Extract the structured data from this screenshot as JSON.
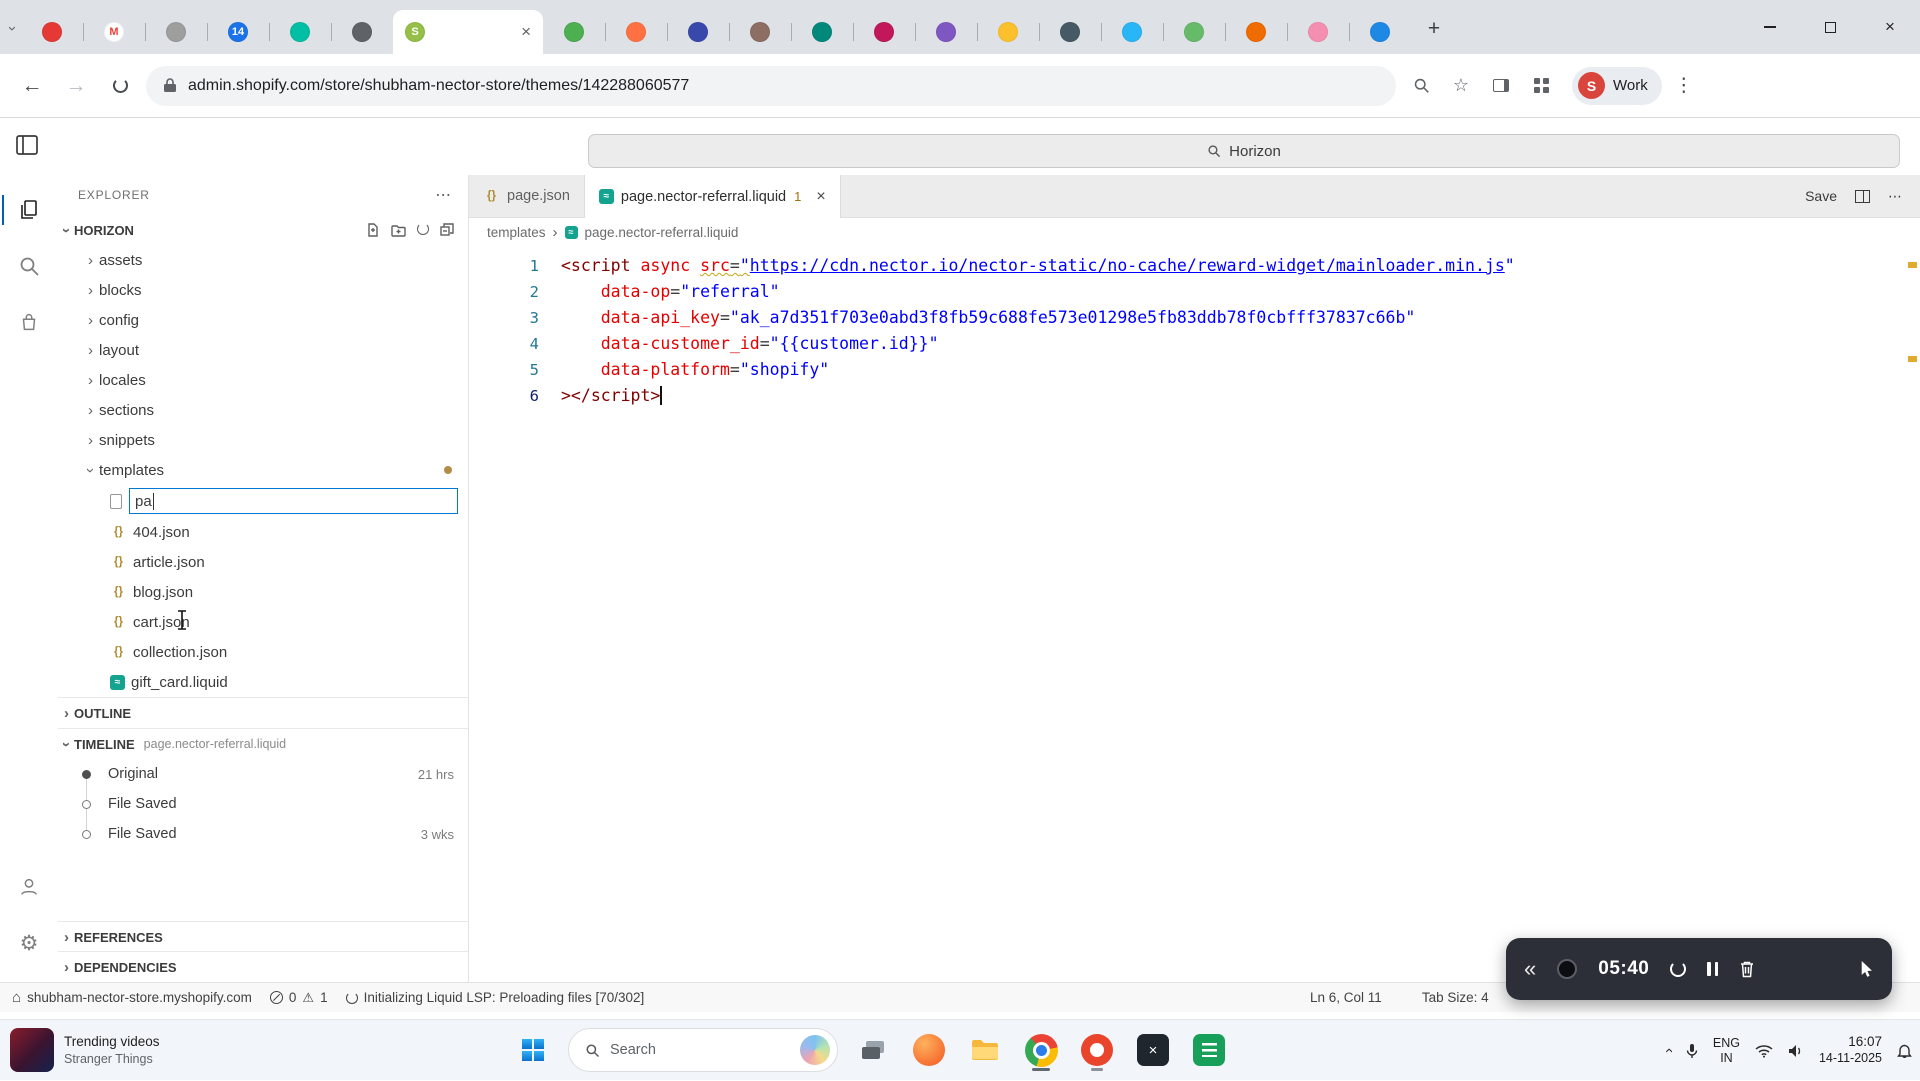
{
  "icons": {
    "chevron": "›",
    "more": "⋯",
    "kebab": "⋮",
    "close": "×",
    "plus": "+",
    "back": "←",
    "forward": "→",
    "guillemet": "«",
    "gear": "⚙",
    "warning": "⚠",
    "house": "⌂",
    "star": "☆",
    "json": "{}",
    "liquid": "≈"
  },
  "browser": {
    "tabs": [
      {
        "color": "#e53935"
      },
      {
        "color": "#ffffff",
        "letter": "M",
        "letter_color": "#ea4335"
      },
      {
        "color": "#9e9e9e"
      },
      {
        "color": "#1a73e8",
        "letter": "14"
      },
      {
        "color": "#00bfa5"
      },
      {
        "color": "#5f6368"
      },
      {
        "color": "#95bf47",
        "letter": "S",
        "active": true
      },
      {
        "color": "#4caf50"
      },
      {
        "color": "#ff7043"
      },
      {
        "color": "#3949ab"
      },
      {
        "color": "#8d6e63"
      },
      {
        "color": "#00897b"
      },
      {
        "color": "#c2185b"
      },
      {
        "color": "#7e57c2"
      },
      {
        "color": "#fbc02d"
      },
      {
        "color": "#455a64"
      },
      {
        "color": "#29b6f6"
      },
      {
        "color": "#66bb6a"
      },
      {
        "color": "#ef6c00"
      },
      {
        "color": "#f48fb1"
      },
      {
        "color": "#1e88e5"
      }
    ],
    "url": "admin.shopify.com/store/shubham-nector-store/themes/142288060577",
    "profile_name": "Work",
    "profile_initial": "S"
  },
  "command_center": {
    "label": "Horizon"
  },
  "explorer": {
    "title": "EXPLORER",
    "section": "HORIZON",
    "folders": [
      "assets",
      "blocks",
      "config",
      "layout",
      "locales",
      "sections",
      "snippets"
    ],
    "expanded_folder": "templates",
    "new_file_value": "pa",
    "files": [
      {
        "name": "404.json",
        "type": "json"
      },
      {
        "name": "article.json",
        "type": "json"
      },
      {
        "name": "blog.json",
        "type": "json"
      },
      {
        "name": "cart.json",
        "type": "json"
      },
      {
        "name": "collection.json",
        "type": "json"
      },
      {
        "name": "gift_card.liquid",
        "type": "liquid"
      }
    ],
    "outline_title": "OUTLINE",
    "timeline_title": "TIMELINE",
    "timeline_file": "page.nector-referral.liquid",
    "timeline_entries": [
      {
        "label": "Original",
        "time": "21 hrs",
        "filled": true
      },
      {
        "label": "File Saved",
        "time": "",
        "filled": false
      },
      {
        "label": "File Saved",
        "time": "3 wks",
        "filled": false
      }
    ],
    "references_title": "REFERENCES",
    "dependencies_title": "DEPENDENCIES"
  },
  "editor": {
    "tabs": [
      {
        "name": "page.json",
        "type": "json",
        "active": false
      },
      {
        "name": "page.nector-referral.liquid",
        "type": "liquid",
        "active": true,
        "badge": "1"
      }
    ],
    "save_label": "Save",
    "breadcrumbs": [
      "templates",
      "page.nector-referral.liquid"
    ],
    "code_lines": [
      {
        "n": "1",
        "tokens": [
          {
            "t": "<script",
            "c": "tag"
          },
          {
            "t": " "
          },
          {
            "t": "async",
            "c": "attr"
          },
          {
            "t": " "
          },
          {
            "t": "src",
            "c": "attr sq"
          },
          {
            "t": "=",
            "c": "eq sq"
          },
          {
            "t": "\"",
            "c": "str sq"
          },
          {
            "t": "https://cdn.nector.io/nector-static/no-cache/reward-widget/mainloader.min.js",
            "c": "str link"
          },
          {
            "t": "\"",
            "c": "str"
          }
        ]
      },
      {
        "n": "2",
        "tokens": [
          {
            "t": "    "
          },
          {
            "t": "data-op",
            "c": "attr"
          },
          {
            "t": "=",
            "c": "eq"
          },
          {
            "t": "\"referral\"",
            "c": "str"
          }
        ]
      },
      {
        "n": "3",
        "tokens": [
          {
            "t": "    "
          },
          {
            "t": "data-api_key",
            "c": "attr"
          },
          {
            "t": "=",
            "c": "eq"
          },
          {
            "t": "\"ak_a7d351f703e0abd3f8fb59c688fe573e01298e5fb83ddb78f0cbfff37837c66b\"",
            "c": "str"
          }
        ]
      },
      {
        "n": "4",
        "tokens": [
          {
            "t": "    "
          },
          {
            "t": "data-customer_id",
            "c": "attr"
          },
          {
            "t": "=",
            "c": "eq"
          },
          {
            "t": "\"{{customer.id}}\"",
            "c": "str"
          }
        ]
      },
      {
        "n": "5",
        "tokens": [
          {
            "t": "    "
          },
          {
            "t": "data-platform",
            "c": "attr"
          },
          {
            "t": "=",
            "c": "eq"
          },
          {
            "t": "\"shopify\"",
            "c": "str"
          }
        ]
      },
      {
        "n": "6",
        "cur": true,
        "tokens": [
          {
            "t": "></",
            "c": "tag"
          },
          {
            "t": "script",
            "c": "tag"
          },
          {
            "t": ">",
            "c": "tag"
          },
          {
            "t": "",
            "c": "caret"
          }
        ]
      }
    ]
  },
  "status_bar": {
    "store": "shubham-nector-store.myshopify.com",
    "errors": "0",
    "warnings": "1",
    "message": "Initializing Liquid LSP: Preloading files [70/302]",
    "line_col": "Ln 6, Col 11",
    "tab_size": "Tab Size: 4"
  },
  "recorder": {
    "time": "05:40"
  },
  "taskbar": {
    "widget_title": "Trending videos",
    "widget_subtitle": "Stranger Things",
    "search_label": "Search",
    "lang_primary": "ENG",
    "lang_secondary": "IN",
    "time": "16:07",
    "date": "14-11-2025"
  },
  "colors": {
    "accent_blue": "#0078d4",
    "warning": "#bf8803",
    "shopify_green": "#95bf47",
    "liquid_teal": "#14a38f"
  }
}
